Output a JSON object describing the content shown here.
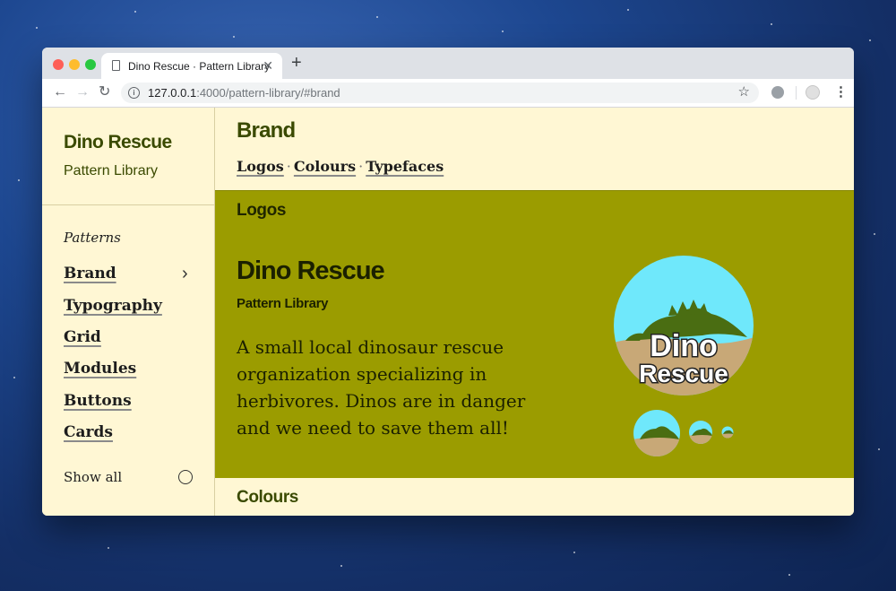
{
  "browser": {
    "tab_title": "Dino Rescue · Pattern Library",
    "url_host": "127.0.0.1",
    "url_rest": ":4000/pattern-library/#brand"
  },
  "sidebar": {
    "title": "Dino Rescue",
    "subtitle": "Pattern Library",
    "section_heading": "Patterns",
    "items": [
      {
        "label": "Brand"
      },
      {
        "label": "Typography"
      },
      {
        "label": "Grid"
      },
      {
        "label": "Modules"
      },
      {
        "label": "Buttons"
      },
      {
        "label": "Cards"
      }
    ],
    "show_all": "Show all"
  },
  "main": {
    "heading": "Brand",
    "sublinks": [
      "Logos",
      "Colours",
      "Typefaces"
    ],
    "logos_heading": "Logos",
    "logo_title": "Dino Rescue",
    "logo_subtitle": "Pattern Library",
    "description": "A small local dinosaur rescue organization specializing in herbivores. Dinos are in danger and we need to save them all!",
    "logo_text_line1": "Dino",
    "logo_text_line2": "Rescue",
    "colours_heading": "Colours"
  },
  "colors": {
    "olive_panel": "#9b9c00",
    "cream": "#fff7d4",
    "sky": "#6fe8fb",
    "dino_green": "#4a6d12",
    "sand": "#c8a877"
  }
}
